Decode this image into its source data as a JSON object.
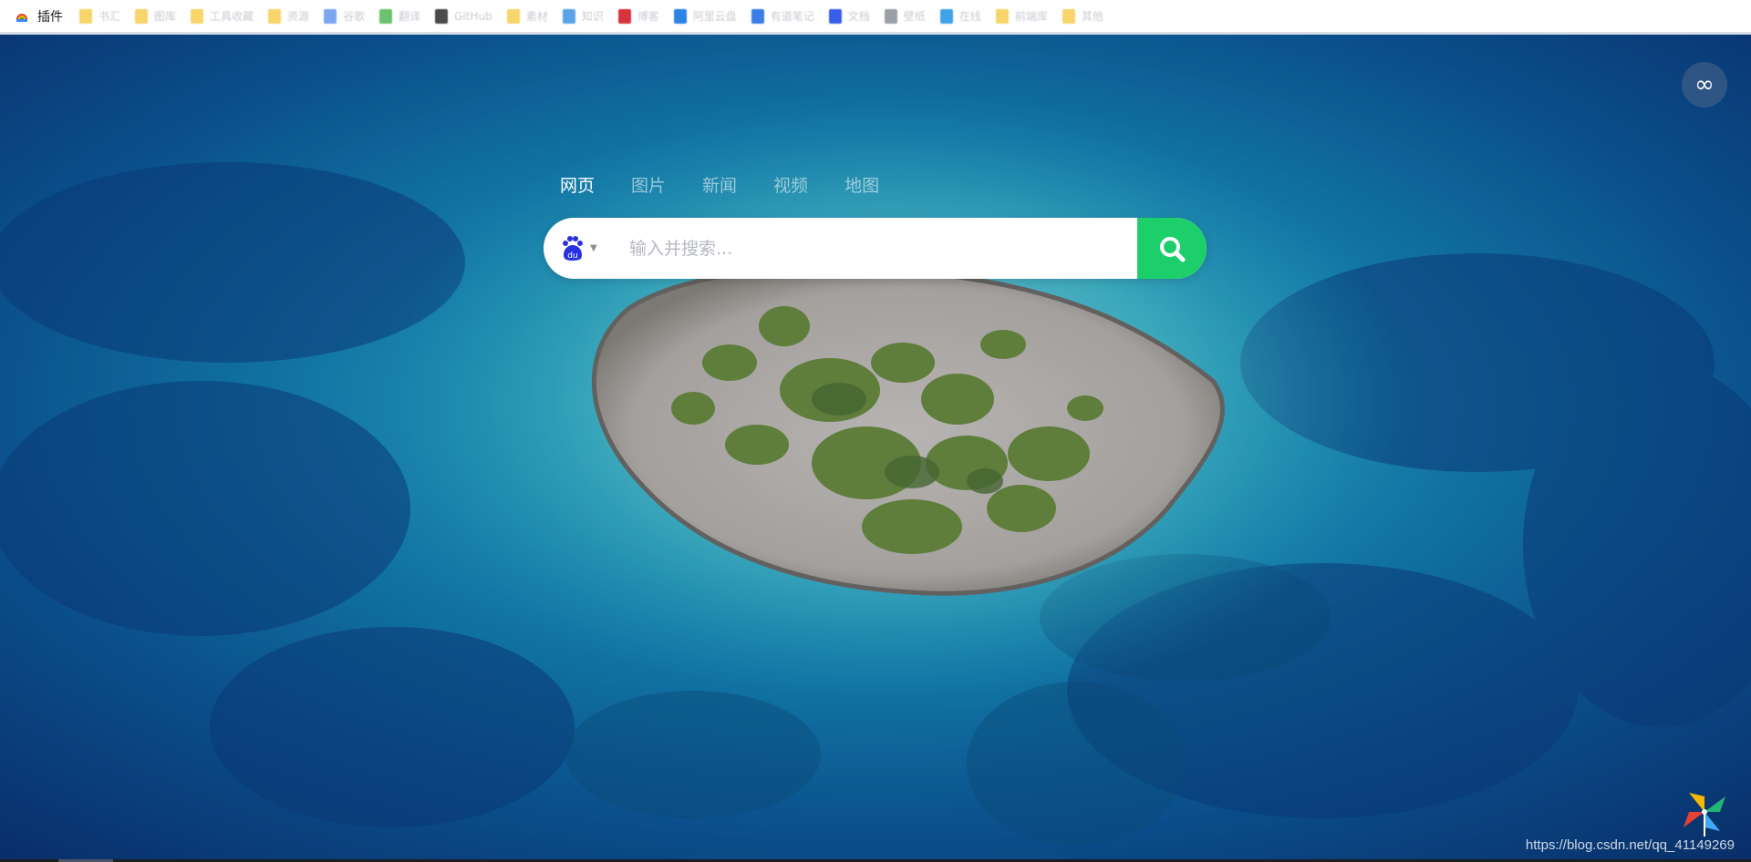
{
  "bookmarks_bar": {
    "first_label": "插件",
    "items": [
      {
        "label": "书汇",
        "color": "#f7d56b"
      },
      {
        "label": "图库",
        "color": "#f7d56b"
      },
      {
        "label": "工具收藏",
        "color": "#f7d56b"
      },
      {
        "label": "资源",
        "color": "#f7d56b"
      },
      {
        "label": "谷歌",
        "color": "#7aa7f0"
      },
      {
        "label": "翻译",
        "color": "#6cc26f"
      },
      {
        "label": "GitHub",
        "color": "#4a4a4a"
      },
      {
        "label": "素材",
        "color": "#f7d56b"
      },
      {
        "label": "知识",
        "color": "#5aa3e8"
      },
      {
        "label": "博客",
        "color": "#d6343c"
      },
      {
        "label": "阿里云盘",
        "color": "#2d82e6"
      },
      {
        "label": "有道笔记",
        "color": "#3b7ee8"
      },
      {
        "label": "文档",
        "color": "#3b5ee8"
      },
      {
        "label": "壁纸",
        "color": "#9aa0a6"
      },
      {
        "label": "在线",
        "color": "#3ea3e8"
      },
      {
        "label": "前端库",
        "color": "#f7d56b"
      },
      {
        "label": "其他",
        "color": "#f7d56b"
      }
    ]
  },
  "tabs": [
    "网页",
    "图片",
    "新闻",
    "视频",
    "地图"
  ],
  "active_tab": "网页",
  "search": {
    "engine": "baidu-logo",
    "placeholder": "输入并搜索...",
    "value": ""
  },
  "corner_button": {
    "icon": "infinity-icon",
    "symbol": "∞"
  },
  "watermark": "https://blog.csdn.net/qq_41149269",
  "colors": {
    "accent": "#1ccf6a",
    "baidu_blue": "#2932e1"
  }
}
